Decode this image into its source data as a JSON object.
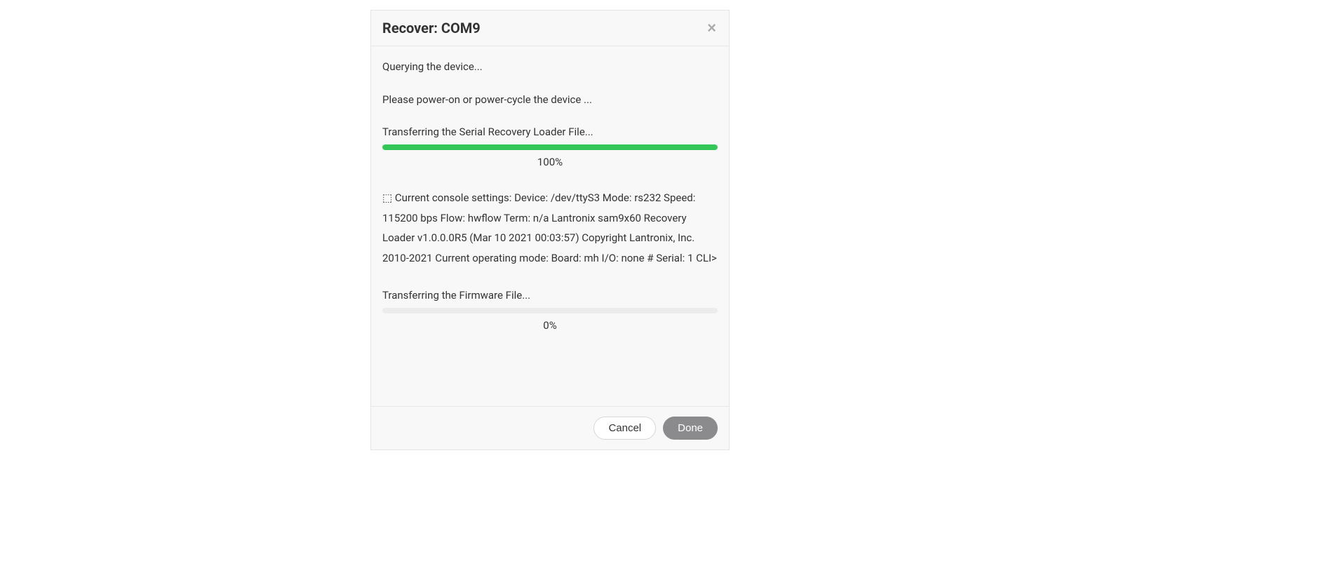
{
  "modal": {
    "title": "Recover: COM9",
    "close_label": "×",
    "body": {
      "status_querying": "Querying the device...",
      "status_powercycle": "Please power-on or power-cycle the device ...",
      "status_transfer_loader": "Transferring the Serial Recovery Loader File...",
      "progress_loader": {
        "percent_value": 100,
        "percent_label": "100%"
      },
      "console_text": "⬚ Current console settings: Device: /dev/ttyS3 Mode: rs232 Speed: 115200 bps Flow: hwflow Term: n/a  Lantronix sam9x60 Recovery Loader v1.0.0.0R5 (Mar 10 2021 00:03:57) Copyright Lantronix, Inc. 2010-2021 Current operating mode: Board: mh I/O: none # Serial: 1  CLI>",
      "status_transfer_firmware": "Transferring the Firmware File...",
      "progress_firmware": {
        "percent_value": 0,
        "percent_label": "0%"
      }
    },
    "footer": {
      "cancel_label": "Cancel",
      "done_label": "Done"
    }
  }
}
